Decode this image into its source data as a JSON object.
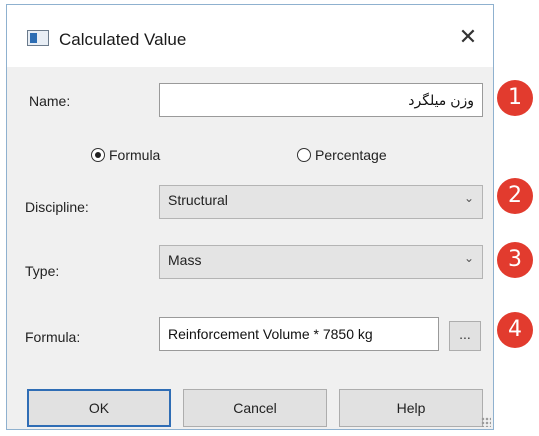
{
  "dialog": {
    "title": "Calculated Value",
    "close_label": "✕"
  },
  "form": {
    "name_label": "Name:",
    "name_value": "وزن میلگرد",
    "radio_formula": "Formula",
    "radio_percentage": "Percentage",
    "selected_mode": "Formula",
    "discipline_label": "Discipline:",
    "discipline_value": "Structural",
    "type_label": "Type:",
    "type_value": "Mass",
    "formula_label": "Formula:",
    "formula_value": "Reinforcement Volume * 7850 kg",
    "ellipsis_label": "..."
  },
  "buttons": {
    "ok": "OK",
    "cancel": "Cancel",
    "help": "Help"
  },
  "annotations": {
    "badge_1": "1",
    "badge_2": "2",
    "badge_3": "3",
    "badge_4": "4",
    "badge_color": "#e23b2e"
  }
}
